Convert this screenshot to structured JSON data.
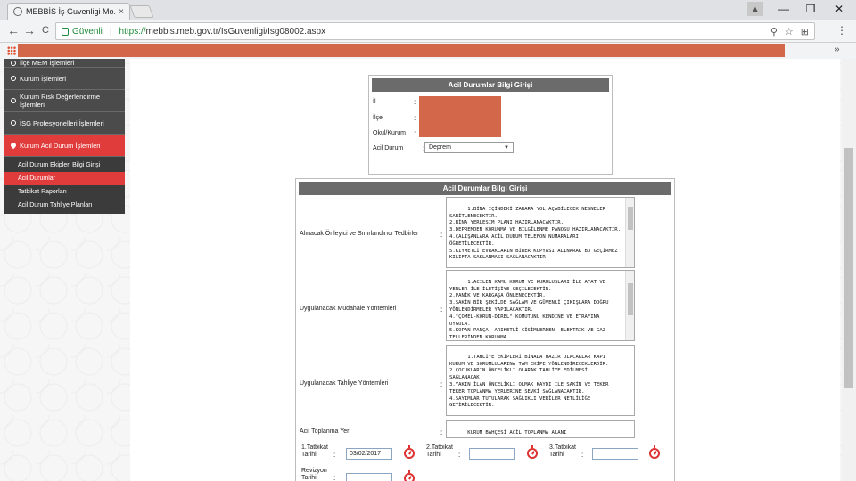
{
  "browser": {
    "tab_title": "MEBBİS İş Guvenligi Mo...",
    "tab_close": "×",
    "profile_icon": "▲",
    "minimize": "—",
    "restore": "❐",
    "close": "✕",
    "back": "←",
    "forward": "→",
    "reload": "C",
    "secure_label": "Güvenli",
    "separator": "|",
    "url_scheme": "https://",
    "url_rest": "mebbis.meb.gov.tr/IsGuvenligi/Isg08002.aspx",
    "search_icon": "⚲",
    "star_icon": "☆",
    "ext_icon": "⊞",
    "menu_icon": "⋮",
    "bookmarks_chevron": "»"
  },
  "sidebar": {
    "items": [
      {
        "label": "İlçe MEM İşlemleri"
      },
      {
        "label": "Kurum İşlemleri"
      },
      {
        "label": "Kurum Risk Değerlendirme İşlemleri"
      },
      {
        "label": "İSG Profesyonelleri İşlemleri"
      },
      {
        "label": "Kurum Acil Durum İşlemleri"
      }
    ],
    "subitems": [
      {
        "label": "Acil Durum Ekipleri Bilgi Girişi"
      },
      {
        "label": "Acil Durumlar"
      },
      {
        "label": "Tatbikat Raporları"
      },
      {
        "label": "Acil Durum Tahliye Planları"
      }
    ]
  },
  "info_panel": {
    "title": "Acil Durumlar Bilgi Girişi",
    "fields": [
      {
        "label": "İl",
        "colon": ":"
      },
      {
        "label": "İlçe",
        "colon": ":"
      },
      {
        "label": "Okul/Kurum",
        "colon": ":"
      },
      {
        "label": "Acil Durum",
        "colon": ":"
      }
    ],
    "acil_durum_value": "Deprem",
    "select_arrow": "▼"
  },
  "main_panel": {
    "title": "Acil Durumlar Bilgi Girişi",
    "rows": [
      {
        "label": "Alınacak Önleyici ve Sınırlandırıcı Tedbirler",
        "colon": ":",
        "text": "1.BİNA İÇİNDEKİ ZARARA YOL AÇABİLECEK NESNELER SABİTLENECEKTİR.\n2.BİNA YERLEŞİM PLANI HAZIRLANACAKTIR.\n3.DEPREMDEN KORUNMA VE BİLGİLENME PANOSU HAZIRLANACAKTIR.\n4.ÇALIŞANLARA ACİL DURUM TELEFON NUMARALARI ÖĞRETİLECEKTİR.\n5.KIYMETLİ EVRAKLARIN BİRER KOPYASI ALINARAK BU GEÇİRMEZ KILIFTA SAKLANMASI SAĞLANACAKTIR."
      },
      {
        "label": "Uygulanacak Müdahale Yöntemleri",
        "colon": ":",
        "text": "1.ACİLEN KAMU KURUM VE KURULUŞLARI İLE AFAT VE YERLER İLE İLETİŞİYE GEÇİLECEKTİR.\n2.PANİK VE KARGAŞA ÖNLENECEKTİR.\n3.SAKİN BİR ŞEKİLDE SAĞLAM VE GÜVENLİ ÇIKIŞLARA DOĞRU YÖNLENDİRMELER YAPILACAKTIR.\n4.\"ÇÖMEL-KORUN-DİREL\" KOMUTUNU KENDİNE VE ETRAFINA UYGULA.\n5.KOPAN PARÇA, ARIKETLİ CİSİMLERDEN, ELEKTRİK VE GAZ TELLERİNDEN KORUNMA."
      },
      {
        "label": "Uygulanacak Tahliye Yöntemleri",
        "colon": ":",
        "text": "1.TAHLİYE EKİPLERİ BİNADA HAZIR OLACAKLAR KAPI KURUM VE SORUMLULARINA TAM EKİPE YÖNLENDİRECEKLERDİR.\n2.ÇOCUKLARIN ÖNCELİKLİ OLARAK TAHLİYE EDİLMESİ SAĞLANACAK.\n3.YAKIN İLAN ÖNCELİKLİ OLMAK KAYDI İLE SAKİN VE TEKER TEKER TOPLANMA YERLERİNE SEVKİ SAĞLANACAKTIR.\n4.SAYIMLAR TUTULARAK SAĞLIKLI VERİLER NETLİLİĞE GETİRİLECEKTİR."
      },
      {
        "label": "Acil Toplanma Yeri",
        "colon": ":",
        "text": "KURUM BAHÇESİ ACİL TOPLANMA ALANI"
      }
    ],
    "dates": [
      {
        "label": "1.Tatbikat Tarihi",
        "colon": ":",
        "value": "03/02/2017"
      },
      {
        "label": "2.Tatbikat Tarihi",
        "colon": ":",
        "value": ""
      },
      {
        "label": "3.Tatbikat Tarihi",
        "colon": ":",
        "value": ""
      },
      {
        "label": "Revizyon Tarihi",
        "colon": ":",
        "value": ""
      }
    ]
  }
}
